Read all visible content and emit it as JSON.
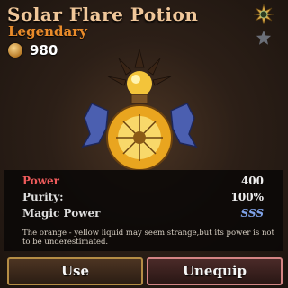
{
  "item": {
    "name": "Solar Flare Potion",
    "rarity": "Legendary",
    "price": "980",
    "rarity_icon": "sun-emblem-icon",
    "favorite_icon": "star-icon",
    "currency_icon": "gold-coin-icon"
  },
  "stats": [
    {
      "label": "Power",
      "value": "400"
    },
    {
      "label": "Purity:",
      "value": "100%"
    },
    {
      "label": "Magic Power",
      "value": "SSS"
    }
  ],
  "description": "The orange - yellow liquid may seem strange,but its power is not to be underestimated.",
  "buttons": {
    "use": "Use",
    "unequip": "Unequip"
  },
  "colors": {
    "title": "#f0c79a",
    "rarity": "#e98b2a",
    "power_label": "#ef5b5b",
    "magic_value": "#7fa2e8"
  }
}
